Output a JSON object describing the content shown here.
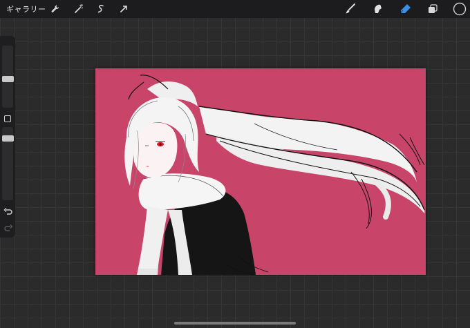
{
  "topbar": {
    "gallery_label": "ギャラリー",
    "left_tools": [
      "wrench-icon",
      "magic-wand-icon",
      "selection-icon",
      "transform-arrow-icon"
    ],
    "right_tools": [
      "brush-icon",
      "smudge-icon",
      "eraser-icon",
      "layers-icon",
      "color-swatch"
    ],
    "active_tool": "eraser",
    "active_color": "#3a8ee6",
    "current_color": "#1c1c1e"
  },
  "sidebar": {
    "controls": [
      "brush-size-slider",
      "modify-button",
      "opacity-slider",
      "undo-button",
      "redo-button"
    ]
  },
  "canvas": {
    "background_color": "#c84569",
    "artwork": "sketch-illustration"
  }
}
